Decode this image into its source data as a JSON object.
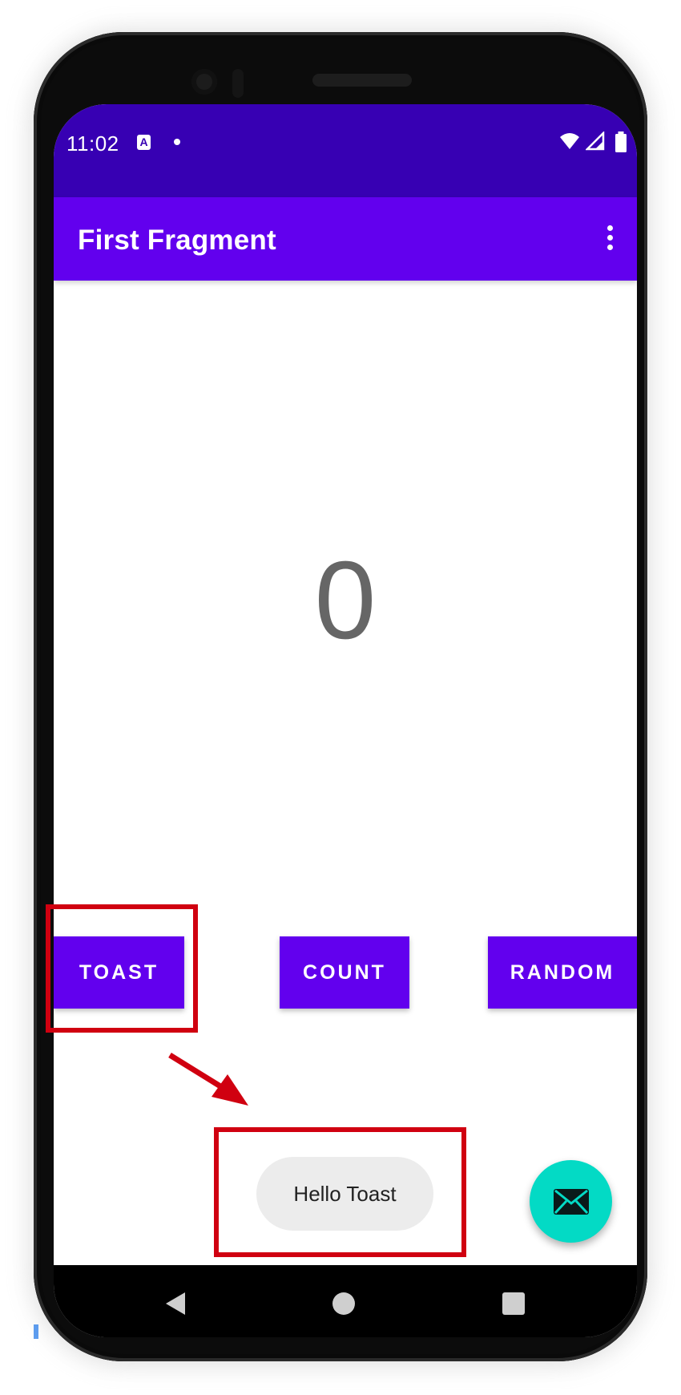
{
  "status_bar": {
    "time": "11:02",
    "notification_icon_glyph": "A",
    "icons": [
      "wifi-icon",
      "signal-icon",
      "battery-icon"
    ]
  },
  "app_bar": {
    "title": "First Fragment",
    "overflow_icon": "more-vert-icon"
  },
  "main": {
    "count_value": "0"
  },
  "buttons": {
    "toast_label": "TOAST",
    "count_label": "COUNT",
    "random_label": "RANDOM"
  },
  "toast_message": "Hello Toast",
  "fab": {
    "icon": "email-icon"
  },
  "nav_bar": {
    "icons": [
      "back-icon",
      "home-icon",
      "recents-icon"
    ]
  },
  "colors": {
    "status_bar": "#3700b3",
    "primary": "#6200ee",
    "fab": "#03dac5",
    "count_text": "#666666",
    "toast_bg": "#ececec",
    "annotation": "#d00010"
  }
}
